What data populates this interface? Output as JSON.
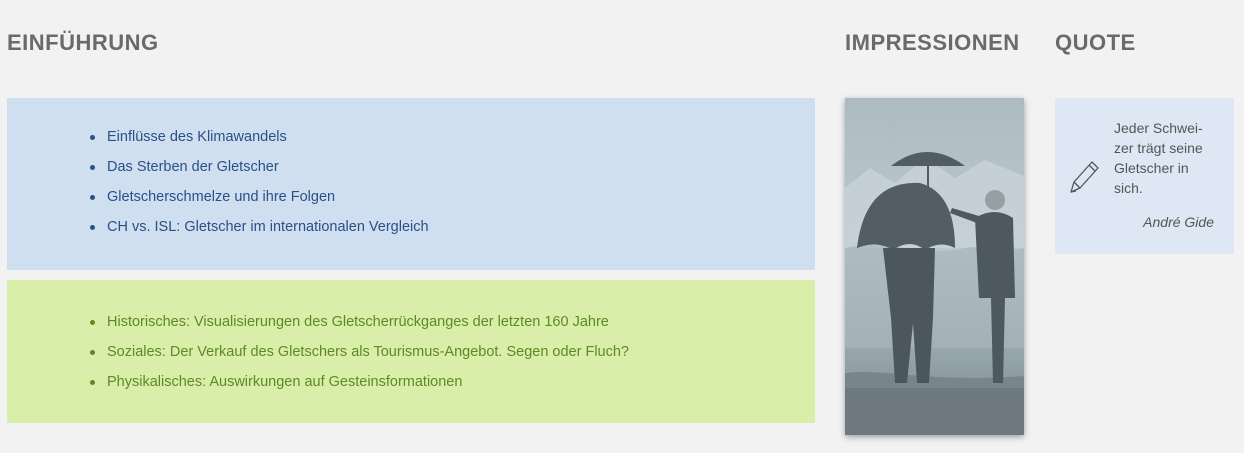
{
  "headings": {
    "intro": "EINFÜHRUNG",
    "impressions": "IMPRESSIONEN",
    "quote": "QUOTE"
  },
  "intro_links": [
    "Einflüsse des Klimawandels",
    "Das Sterben der Gletscher",
    "Gletscherschmelze und ihre Folgen",
    "CH vs. ISL: Gletscher im internationalen Vergleich"
  ],
  "topic_links": [
    "Historisches: Visualisierungen des Gletscherrückganges der letzten 160 Jahre",
    "Soziales: Der Verkauf des Gletschers als Tourismus-Angebot. Segen oder Fluch?",
    "Physikalisches: Auswirkungen auf Gesteinsformationen"
  ],
  "quote": {
    "text": "Jeder Schwei-zer trägt seine Gletscher in sich.",
    "author": "André Gide",
    "icon": "pencil-icon"
  },
  "colors": {
    "intro_box": "#cfdfef",
    "intro_text": "#2b4f87",
    "topic_box": "#d8eea9",
    "topic_text": "#5e8a25",
    "quote_box": "#dde8f4"
  }
}
